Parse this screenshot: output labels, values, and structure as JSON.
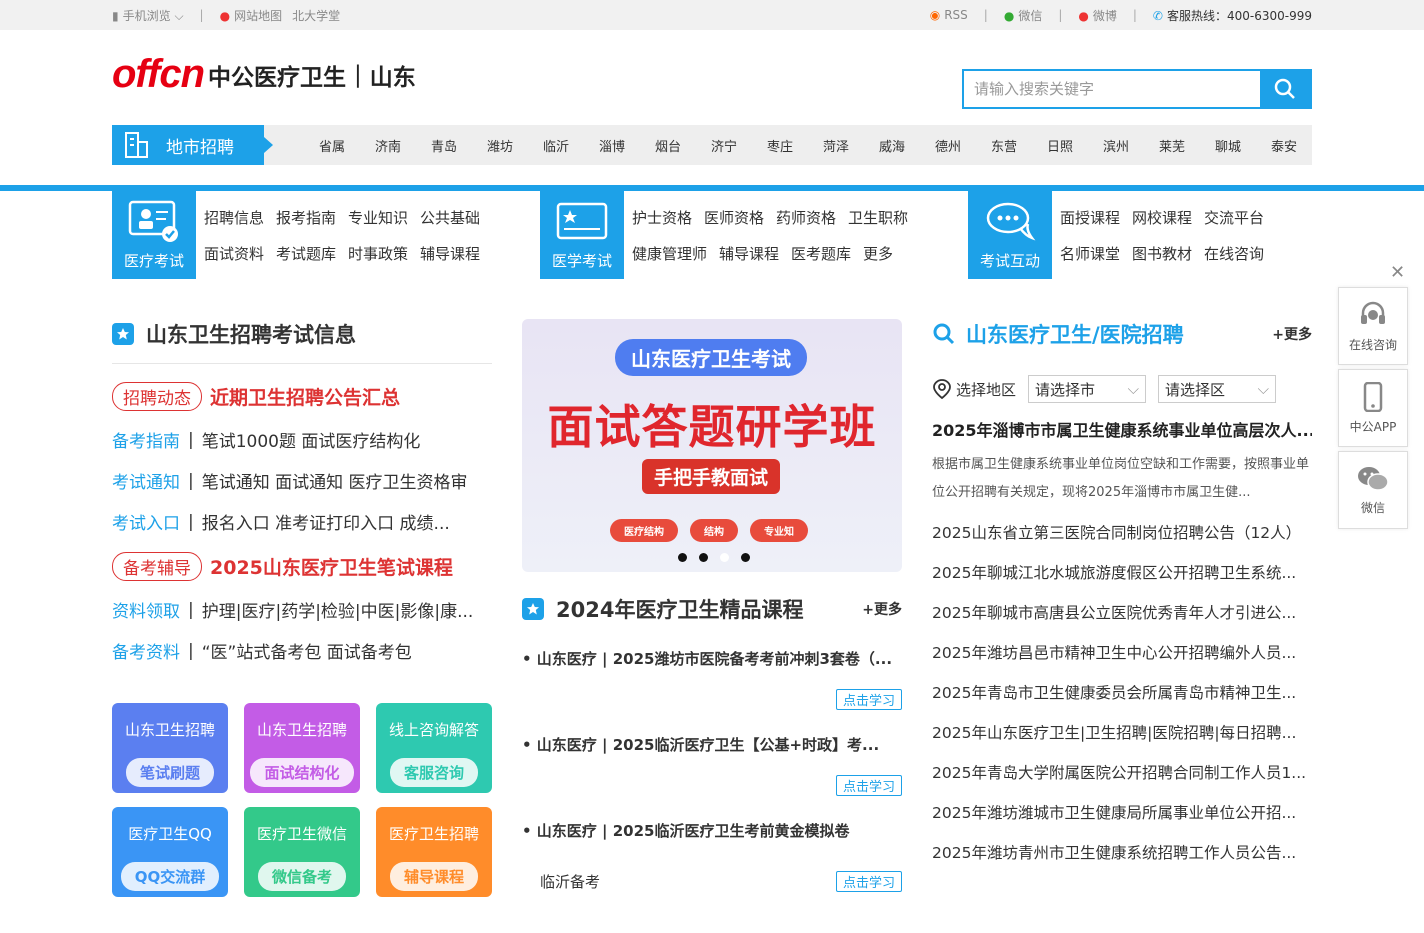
{
  "topbar": {
    "mobile": "手机浏览",
    "sitemap": "网站地图",
    "school": "北大学堂",
    "rss": "RSS",
    "wechat": "微信",
    "weibo": "微博",
    "hotline": "客服热线：400-6300-999"
  },
  "header": {
    "logo_text": "offcn",
    "brand": "中公医疗卫生",
    "province": "山东",
    "search_placeholder": "请输入搜索关键字"
  },
  "citynav": {
    "title": "地市招聘",
    "cities": [
      "省属",
      "济南",
      "青岛",
      "潍坊",
      "临沂",
      "淄博",
      "烟台",
      "济宁",
      "枣庄",
      "菏泽",
      "威海",
      "德州",
      "东营",
      "日照",
      "滨州",
      "莱芜",
      "聊城",
      "泰安"
    ]
  },
  "catnav": {
    "exam": {
      "label": "医疗考试",
      "row1": [
        "招聘信息",
        "报考指南",
        "专业知识",
        "公共基础"
      ],
      "row2": [
        "面试资料",
        "考试题库",
        "时事政策",
        "辅导课程"
      ]
    },
    "med": {
      "label": "医学考试",
      "row1": [
        "护士资格",
        "医师资格",
        "药师资格",
        "卫生职称"
      ],
      "row2": [
        "健康管理师",
        "辅导课程",
        "医考题库",
        "更多"
      ]
    },
    "interact": {
      "label": "考试互动",
      "row1": [
        "面授课程",
        "网校课程",
        "交流平台"
      ],
      "row2": [
        "名师课堂",
        "图书教材",
        "在线咨询"
      ]
    }
  },
  "col1": {
    "title": "山东卫生招聘考试信息",
    "tag1": "招聘动态",
    "head1": "近期卫生招聘公告汇总",
    "rows1": [
      {
        "k": "备考指南",
        "v": "笔试1000题  面试医疗结构化"
      },
      {
        "k": "考试通知",
        "v": "笔试通知  面试通知  医疗卫生资格审"
      },
      {
        "k": "考试入口",
        "v": "报名入口  准考证打印入口  成绩..."
      }
    ],
    "tag2": "备考辅导",
    "head2": "2025山东医疗卫生笔试课程",
    "rows2": [
      {
        "k": "资料领取",
        "v": "护理|医疗|药学|检验|中医|影像|康..."
      },
      {
        "k": "备考资料",
        "v": "“医”站式备考包  面试备考包"
      }
    ],
    "tiles": [
      {
        "title": "山东卫生招聘",
        "btn": "笔试刷题",
        "color": "#5b7ff0"
      },
      {
        "title": "山东卫生招聘",
        "btn": "面试结构化",
        "color": "#c35ce6"
      },
      {
        "title": "线上咨询解答",
        "btn": "客服咨询",
        "color": "#2ec9b0"
      },
      {
        "title": "医疗卫生QQ",
        "btn": "QQ交流群",
        "color": "#3a95f5"
      },
      {
        "title": "医疗卫生微信",
        "btn": "微信备考",
        "color": "#33c98a"
      },
      {
        "title": "医疗卫生招聘",
        "btn": "辅导课程",
        "color": "#ff8c2a"
      }
    ]
  },
  "col2": {
    "banner": {
      "top": "山东医疗卫生考试",
      "main": "面试答题研学班",
      "sub": "手把手教面试",
      "pills": [
        "医疗结构",
        "结构",
        "专业知"
      ]
    },
    "title": "2024年医疗卫生精品课程",
    "more": "+更多",
    "courses": [
      "• 山东医疗 | 2025潍坊市医院备考考前冲刺3套卷（...",
      "• 山东医疗 | 2025临沂医疗卫生【公基+时政】考...",
      "• 山东医疗 | 2025临沂医疗卫生考前黄金模拟卷"
    ],
    "study": "点击学习",
    "last": "临沂备考"
  },
  "col3": {
    "title": "山东医疗卫生/医院招聘",
    "more": "+更多",
    "region_label": "选择地区",
    "city_select": "请选择市",
    "district_select": "请选择区",
    "head": "2025年淄博市市属卫生健康系统事业单位高层次人...",
    "desc": "根据市属卫生健康系统事业单位岗位空缺和工作需要，按照事业单位公开招聘有关规定，现将2025年淄博市市属卫生健...",
    "items": [
      "2025山东省立第三医院合同制岗位招聘公告（12人）",
      "2025年聊城江北水城旅游度假区公开招聘卫生系统...",
      "2025年聊城市高唐县公立医院优秀青年人才引进公...",
      "2025年潍坊昌邑市精神卫生中心公开招聘编外人员...",
      "2025年青岛市卫生健康委员会所属青岛市精神卫生...",
      "2025年山东医疗卫生|卫生招聘|医院招聘|每日招聘...",
      "2025年青岛大学附属医院公开招聘合同制工作人员1...",
      "2025年潍坊潍城市卫生健康局所属事业单位公开招...",
      "2025年潍坊青州市卫生健康系统招聘工作人员公告..."
    ]
  },
  "sidebar": {
    "consult": "在线咨询",
    "app": "中公APP",
    "wechat": "微信"
  },
  "colors": {
    "accent": "#1da1e8",
    "red": "#e60012"
  }
}
